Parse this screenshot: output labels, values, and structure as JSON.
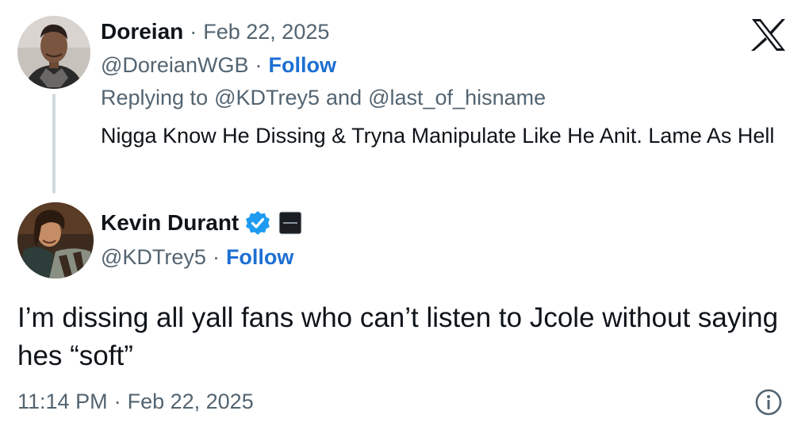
{
  "parent_tweet": {
    "author_name": "Doreian",
    "date": "Feb 22, 2025",
    "handle": "@DoreianWGB",
    "follow_label": "Follow",
    "replying_prefix": "Replying to",
    "replying_user_1": "@KDTrey5",
    "replying_conjunction": "and",
    "replying_user_2": "@last_of_hisname",
    "text": "Nigga Know He Dissing & Tryna Manipulate Like He Anit. Lame As Hell"
  },
  "main_tweet": {
    "author_name": "Kevin Durant",
    "handle": "@KDTrey5",
    "follow_label": "Follow",
    "text": "I’m dissing all yall fans who can’t listen to Jcole without saying hes “soft”",
    "time": "11:14 PM",
    "date": "Feb 22, 2025"
  },
  "separator": "·",
  "icons": {
    "platform_logo": "x-logo-icon",
    "verified_badge": "verified-badge-icon",
    "affiliate_badge": "affiliate-badge-icon",
    "info": "info-icon"
  },
  "colors": {
    "follow": "#1d6fd3",
    "verified": "#1d9bf0",
    "muted": "#536471",
    "thread_line": "#cfd9de"
  }
}
